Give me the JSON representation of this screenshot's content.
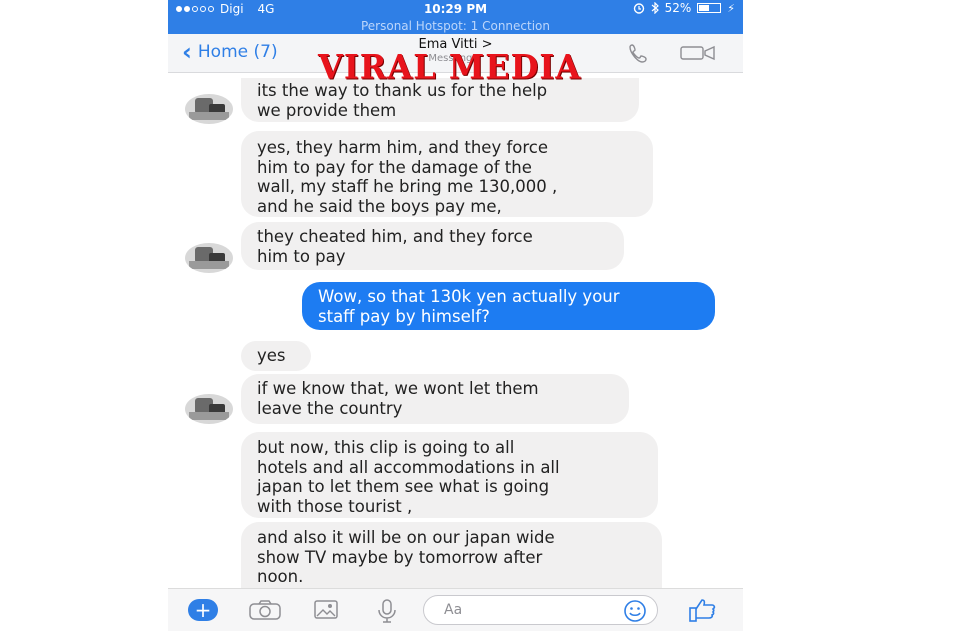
{
  "status": {
    "carrier": "Digi",
    "network": "4G",
    "time": "10:29 PM",
    "battery": "52%",
    "battery_level": 0.52,
    "hotspot": "Personal Hotspot: 1 Connection"
  },
  "header": {
    "back_label": "Home (7)",
    "contact_name": "Ema Vitti >",
    "subtitle": "Messenger"
  },
  "watermark": "VIRAL MEDIA",
  "messages": [
    {
      "from": "them",
      "text": "its the way to thank us for the help\nwe provide them"
    },
    {
      "from": "them",
      "text": "yes, they harm him, and they force\nhim to pay for the damage of the\nwall, my staff he bring me 130,000 ,\nand he said the boys pay me,"
    },
    {
      "from": "them",
      "text": "they cheated him, and they force\nhim to pay"
    },
    {
      "from": "me",
      "text": "Wow, so that 130k yen actually your\nstaff pay by himself?"
    },
    {
      "from": "them",
      "text": "yes"
    },
    {
      "from": "them",
      "text": "if we know that, we wont let them\nleave the country"
    },
    {
      "from": "them",
      "text": "but now, this clip is going to all\nhotels and all accommodations in all\njapan to let them see what is going\nwith those tourist ,"
    },
    {
      "from": "them",
      "text": "and also it will be on our japan wide\nshow TV maybe by tomorrow after\nnoon."
    }
  ],
  "composer": {
    "plus": "+",
    "placeholder": "Aa"
  },
  "icons": [
    "chevron-left-icon",
    "phone-icon",
    "video-camera-icon",
    "camera-icon",
    "image-icon",
    "microphone-icon",
    "smile-icon",
    "thumbs-up-icon",
    "alarm-icon",
    "bluetooth-icon",
    "battery-icon",
    "charging-icon"
  ],
  "colors": {
    "accent": "#2f7fe6",
    "outgoing_bubble": "#1d7cf2",
    "incoming_bubble": "#f1f0f0",
    "watermark": "#e8141c"
  }
}
